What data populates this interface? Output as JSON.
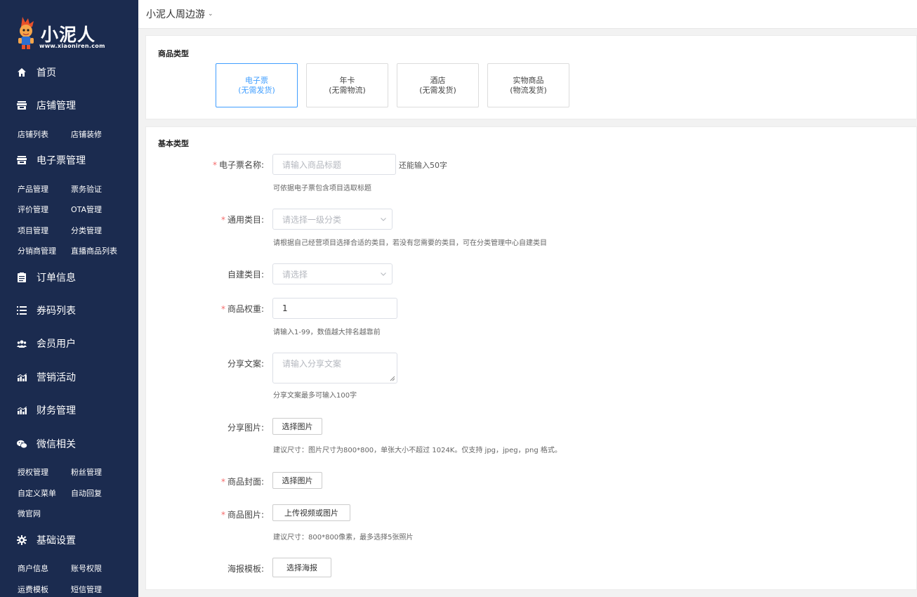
{
  "brand": {
    "name": "小泥人",
    "url": "www.xiaoniren.com"
  },
  "sidebar": {
    "menu": [
      {
        "id": "home",
        "label": "首页",
        "icon": "home-icon"
      },
      {
        "id": "shop",
        "label": "店铺管理",
        "icon": "store-icon"
      },
      {
        "id": "eticket",
        "label": "电子票管理",
        "icon": "store-icon"
      },
      {
        "id": "orders",
        "label": "订单信息",
        "icon": "clipboard-icon"
      },
      {
        "id": "codes",
        "label": "券码列表",
        "icon": "list-icon"
      },
      {
        "id": "members",
        "label": "会员用户",
        "icon": "users-icon"
      },
      {
        "id": "marketing",
        "label": "营销活动",
        "icon": "bar-chart-icon"
      },
      {
        "id": "finance",
        "label": "财务管理",
        "icon": "bar-chart-icon"
      },
      {
        "id": "wechat",
        "label": "微信相关",
        "icon": "wechat-icon"
      },
      {
        "id": "settings",
        "label": "基础设置",
        "icon": "gear-icon"
      }
    ],
    "shop_sub": [
      "店铺列表",
      "店铺装修"
    ],
    "eticket_sub": [
      "产品管理",
      "票务验证",
      "评价管理",
      "OTA管理",
      "项目管理",
      "分类管理",
      "分销商管理",
      "直播商品列表"
    ],
    "wechat_sub": [
      "授权管理",
      "粉丝管理",
      "自定义菜单",
      "自动回复",
      "微官网"
    ],
    "settings_sub": [
      "商户信息",
      "账号权限",
      "运费模板",
      "短信管理"
    ]
  },
  "header": {
    "shop_name": "小泥人周边游"
  },
  "product_type": {
    "title": "商品类型",
    "options": [
      {
        "line1": "电子票",
        "line2": "(无需发货)",
        "active": true
      },
      {
        "line1": "年卡",
        "line2": "(无需物流)",
        "active": false
      },
      {
        "line1": "酒店",
        "line2": "(无需发货)",
        "active": false
      },
      {
        "line1": "实物商品",
        "line2": "(物流发货)",
        "active": false
      }
    ]
  },
  "basic": {
    "title": "基本类型",
    "name": {
      "label": "电子票名称:",
      "placeholder": "请输入商品标题",
      "counter": "还能输入50字",
      "hint": "可依据电子票包含项目选取标题"
    },
    "category": {
      "label": "通用类目:",
      "placeholder": "请选择一级分类",
      "hint": "请根据自己经营项目选择合适的类目，若没有您需要的类目，可在分类管理中心自建类目"
    },
    "custom_category": {
      "label": "自建类目:",
      "placeholder": "请选择"
    },
    "weight": {
      "label": "商品权重:",
      "value": "1",
      "hint": "请输入1-99，数值越大排名越靠前"
    },
    "share_text": {
      "label": "分享文案:",
      "placeholder": "请输入分享文案",
      "hint": "分享文案最多可输入100字"
    },
    "share_image": {
      "label": "分享图片:",
      "button": "选择图片",
      "hint": "建议尺寸：图片尺寸为800*800，单张大小不超过 1024K。仅支持 jpg，jpeg，png 格式。"
    },
    "cover": {
      "label": "商品封面:",
      "button": "选择图片"
    },
    "images": {
      "label": "商品图片:",
      "button": "上传视频或图片",
      "hint": "建议尺寸：800*800像素，最多选择5张照片"
    },
    "poster": {
      "label": "海报模板:",
      "button": "选择海报"
    }
  },
  "colors": {
    "sidebar_bg": "#1b2b4f",
    "accent": "#409eff",
    "required": "#f56c6c"
  }
}
